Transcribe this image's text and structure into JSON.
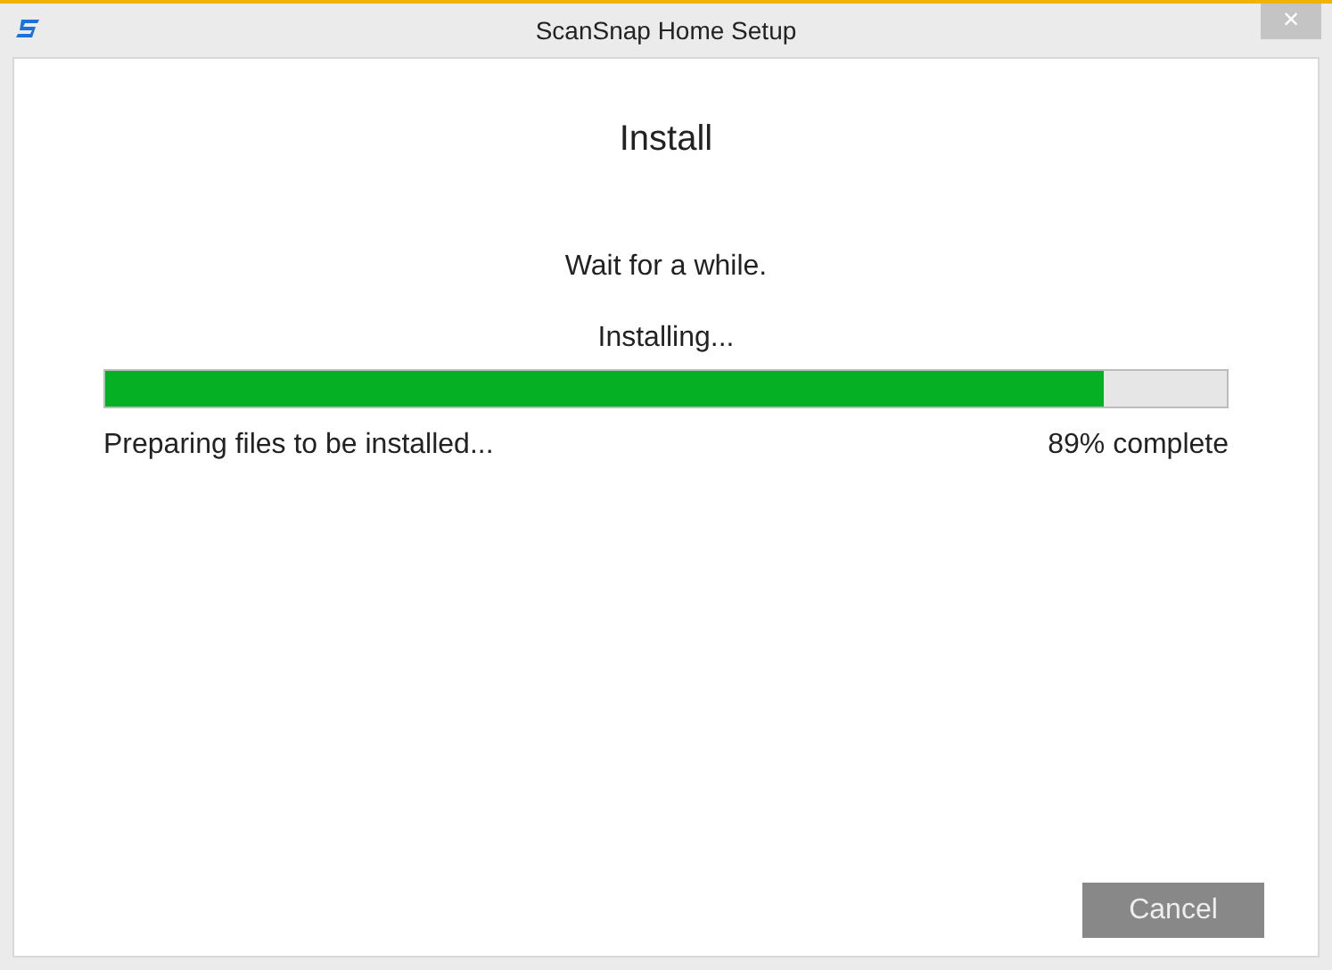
{
  "window": {
    "title": "ScanSnap Home Setup",
    "close": "×"
  },
  "heading": "Install",
  "message": "Wait for a while.",
  "progress": {
    "label": "Installing...",
    "level": 0.89,
    "status": "Preparing files to be installed...",
    "reading": "89% complete"
  },
  "buttons": [
    {
      "label": "Cancel",
      "disabled": true
    }
  ]
}
